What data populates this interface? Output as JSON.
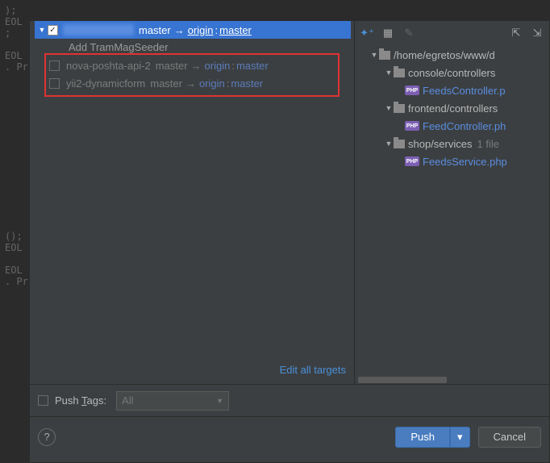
{
  "editor_bg": ");\nEOL\n;\n\nEOL\n. Pr\n\n\n\n\n\n\n\n\n\n\n\n\n\n\n();\nEOL\n\nEOL\n. Pr",
  "commits": {
    "selected": {
      "branch_from": "master",
      "arrow": "→",
      "remote": "origin",
      "sep": ":",
      "branch_to": "master"
    },
    "sub": "Add TramMagSeeder",
    "repos": [
      {
        "name": "nova-poshta-api-2",
        "from": "master",
        "arrow": "→",
        "remote": "origin",
        "sep": ":",
        "to": "master"
      },
      {
        "name": "yii2-dynamicform",
        "from": "master",
        "arrow": "→",
        "remote": "origin",
        "sep": ":",
        "to": "master"
      }
    ],
    "edit_all": "Edit all targets"
  },
  "tree": {
    "root": "/home/egretos/www/d",
    "n1": "console/controllers",
    "f1": "FeedsController.p",
    "n2": "frontend/controllers",
    "f2": "FeedController.ph",
    "n3": "shop/services",
    "c3": "1 file",
    "f3": "FeedsService.php"
  },
  "push_tags": {
    "label_pre": "Push ",
    "label_u": "T",
    "label_post": "ags:",
    "combo": "All"
  },
  "buttons": {
    "push": "Push",
    "cancel": "Cancel"
  },
  "icons": {
    "php": "PHP"
  }
}
